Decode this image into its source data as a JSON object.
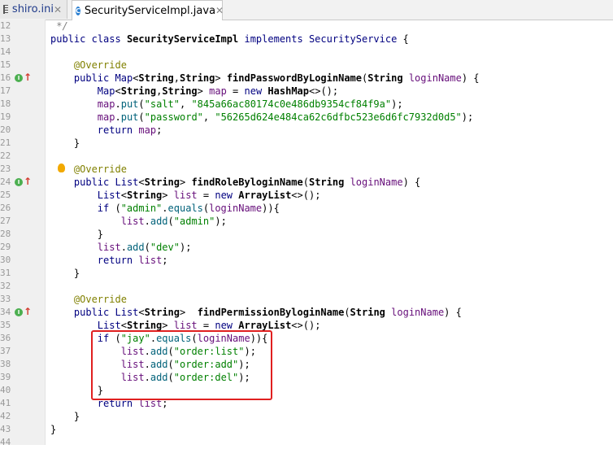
{
  "tabs": [
    {
      "label": "shiro.ini",
      "icon": "ini-file-icon"
    },
    {
      "label": "SecurityServiceImpl.java",
      "icon": "java-class-icon"
    }
  ],
  "editor": {
    "lines": [
      {
        "num": "12",
        "code": " */"
      },
      {
        "num": "13",
        "code": "public class SecurityServiceImpl implements SecurityService {"
      },
      {
        "num": "14",
        "code": ""
      },
      {
        "num": "15",
        "code": "    @Override"
      },
      {
        "num": "16",
        "code": "    public Map<String,String> findPasswordByLoginName(String loginName) {"
      },
      {
        "num": "17",
        "code": "        Map<String,String> map = new HashMap<>();"
      },
      {
        "num": "18",
        "code": "        map.put(\"salt\", \"845a66ac80174c0e486db9354cf84f9a\");"
      },
      {
        "num": "19",
        "code": "        map.put(\"password\", \"56265d624e484ca62c6dfbc523e6d6fc7932d0d5\");"
      },
      {
        "num": "20",
        "code": "        return map;"
      },
      {
        "num": "21",
        "code": "    }"
      },
      {
        "num": "22",
        "code": ""
      },
      {
        "num": "23",
        "code": "    @Override"
      },
      {
        "num": "24",
        "code": "    public List<String> findRoleByloginName(String loginName) {"
      },
      {
        "num": "25",
        "code": "        List<String> list = new ArrayList<>();"
      },
      {
        "num": "26",
        "code": "        if (\"admin\".equals(loginName)){"
      },
      {
        "num": "27",
        "code": "            list.add(\"admin\");"
      },
      {
        "num": "28",
        "code": "        }"
      },
      {
        "num": "29",
        "code": "        list.add(\"dev\");"
      },
      {
        "num": "30",
        "code": "        return list;"
      },
      {
        "num": "31",
        "code": "    }"
      },
      {
        "num": "32",
        "code": ""
      },
      {
        "num": "33",
        "code": "    @Override"
      },
      {
        "num": "34",
        "code": "    public List<String>  findPermissionByloginName(String loginName) {"
      },
      {
        "num": "35",
        "code": "        List<String> list = new ArrayList<>();"
      },
      {
        "num": "36",
        "code": "        if (\"jay\".equals(loginName)){"
      },
      {
        "num": "37",
        "code": "            list.add(\"order:list\");"
      },
      {
        "num": "38",
        "code": "            list.add(\"order:add\");"
      },
      {
        "num": "39",
        "code": "            list.add(\"order:del\");"
      },
      {
        "num": "40",
        "code": "        }"
      },
      {
        "num": "41",
        "code": "        return list;"
      },
      {
        "num": "42",
        "code": "    }"
      },
      {
        "num": "43",
        "code": "}"
      },
      {
        "num": "44",
        "code": ""
      }
    ],
    "override_markers": [
      "16",
      "24",
      "34"
    ],
    "bulb_line": "23",
    "highlight_lines": [
      "36",
      "37",
      "38",
      "39",
      "40"
    ],
    "highlight_color": "#e02020"
  }
}
